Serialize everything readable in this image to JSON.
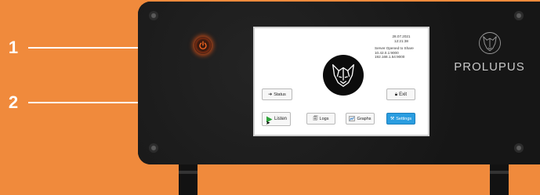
{
  "callouts": [
    {
      "number": "1"
    },
    {
      "number": "2"
    }
  ],
  "device": {
    "brand_name": "PROLUPUS",
    "brand_logo": "wolf-head-outline",
    "power_button_icon": "power-icon",
    "power_glow_color": "#ff5a14",
    "body_color": "#1b1b1b",
    "background_color": "#f08a3c"
  },
  "screen": {
    "date": "28.07.2021",
    "time": "12:21:38",
    "server_status": "Server Opened to Share",
    "ip_addresses": [
      "10.42.0.1:9000",
      "192.168.1.54:9000"
    ],
    "logo": "wolf-head-logo",
    "buttons": {
      "status": {
        "label": "Status",
        "icon": "arrow-icon"
      },
      "exit": {
        "label": "Exit",
        "icon": "lock-icon"
      },
      "listen": {
        "label": "Listen",
        "icon": "play-icon",
        "icon_color": "#2ea43a"
      },
      "logs": {
        "label": "Logs",
        "icon": "logs-icon"
      },
      "graphs": {
        "label": "Graphs",
        "icon": "graph-icon"
      },
      "settings": {
        "label": "Settings",
        "icon": "settings-icon",
        "color": "#2a9de0"
      }
    }
  }
}
